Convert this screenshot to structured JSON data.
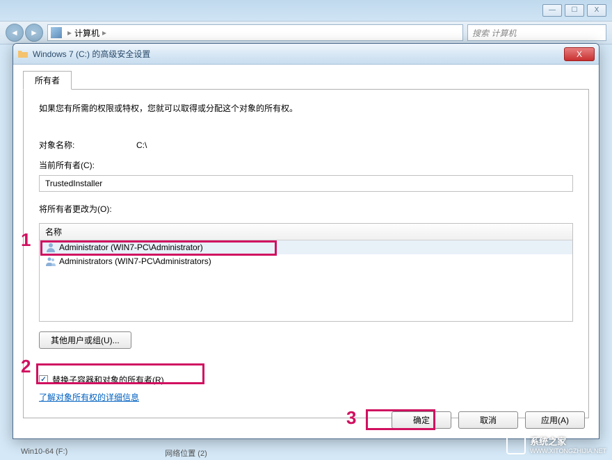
{
  "background": {
    "window_buttons": {
      "min": "—",
      "max": "☐",
      "close": "X"
    },
    "breadcrumb_item": "计算机",
    "search_placeholder": "搜索 计算机",
    "status_left": "Win10-64 (F:)",
    "status_right": "网络位置 (2)"
  },
  "dialog": {
    "title": "Windows 7 (C:) 的高级安全设置",
    "close_glyph": "X",
    "tab": "所有者",
    "info": "如果您有所需的权限或特权，您就可以取得或分配这个对象的所有权。",
    "object_name_label": "对象名称:",
    "object_name_value": "C:\\",
    "current_owner_label": "当前所有者(C):",
    "current_owner_value": "TrustedInstaller",
    "change_owner_label": "将所有者更改为(O):",
    "list": {
      "header": "名称",
      "items": [
        {
          "text": "Administrator (WIN7-PC\\Administrator)",
          "selected": true,
          "icon": "user"
        },
        {
          "text": "Administrators (WIN7-PC\\Administrators)",
          "selected": false,
          "icon": "group"
        }
      ]
    },
    "other_users_btn": "其他用户或组(U)...",
    "replace_checkbox": {
      "label": "替换子容器和对象的所有者(R)",
      "checked": true
    },
    "learn_more_link": "了解对象所有权的详细信息",
    "buttons": {
      "ok": "确定",
      "cancel": "取消",
      "apply": "应用(A)"
    }
  },
  "annotations": {
    "n1": "1",
    "n2": "2",
    "n3": "3"
  },
  "watermark": {
    "text": "系统之家",
    "url": "WWW.XITONGZHIJIA.NET"
  }
}
